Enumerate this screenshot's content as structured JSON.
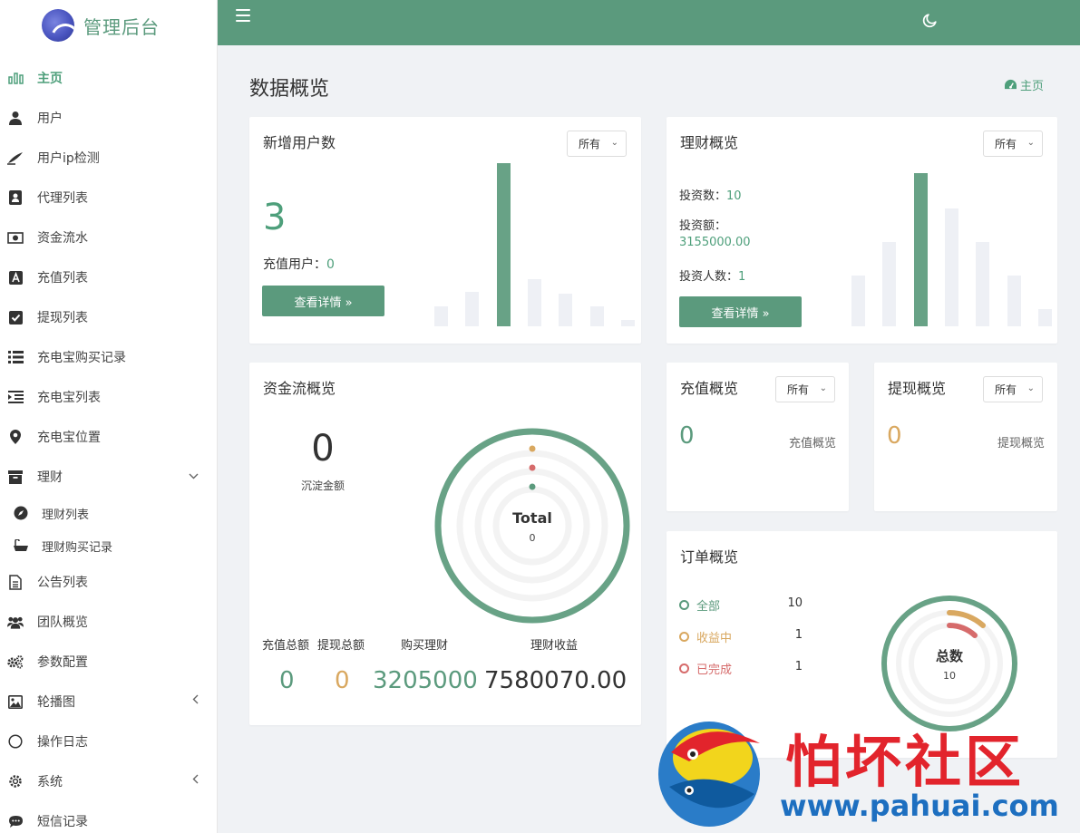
{
  "brand": {
    "name": "管理后台"
  },
  "sidebar": {
    "items": [
      {
        "label": "主页",
        "icon": "bar-chart-icon"
      },
      {
        "label": "用户",
        "icon": "user-icon"
      },
      {
        "label": "用户ip检测",
        "icon": "pen-icon"
      },
      {
        "label": "代理列表",
        "icon": "contact-icon"
      },
      {
        "label": "资金流水",
        "icon": "money-icon"
      },
      {
        "label": "充值列表",
        "icon": "letter-a-icon"
      },
      {
        "label": "提现列表",
        "icon": "check-square-icon"
      },
      {
        "label": "充电宝购买记录",
        "icon": "list-icon"
      },
      {
        "label": "充电宝列表",
        "icon": "indent-icon"
      },
      {
        "label": "充电宝位置",
        "icon": "map-pin-icon"
      },
      {
        "label": "理财",
        "icon": "archive-icon"
      },
      {
        "label": "理财列表",
        "icon": "compass-icon"
      },
      {
        "label": "理财购买记录",
        "icon": "bath-icon"
      },
      {
        "label": "公告列表",
        "icon": "file-text-icon"
      },
      {
        "label": "团队概览",
        "icon": "users-icon"
      },
      {
        "label": "参数配置",
        "icon": "cogs-icon"
      },
      {
        "label": "轮播图",
        "icon": "image-icon"
      },
      {
        "label": "操作日志",
        "icon": "circle-icon"
      },
      {
        "label": "系统",
        "icon": "gear-icon"
      },
      {
        "label": "短信记录",
        "icon": "comment-icon"
      }
    ]
  },
  "header": {
    "page_title": "数据概览",
    "breadcrumb": "主页"
  },
  "select_default": "所有",
  "new_users": {
    "title": "新增用户数",
    "count": "3",
    "recharge_label": "充值用户：",
    "recharge_value": "0",
    "button": "查看详情 »",
    "bars": [
      0.12,
      0.21,
      1.0,
      0.29,
      0.2,
      0.12,
      0.04
    ],
    "highlight": 2
  },
  "finance": {
    "title": "理财概览",
    "invest_count_label": "投资数：",
    "invest_count": "10",
    "invest_amount_label": "投资额：",
    "invest_amount": "3155000.00",
    "investor_label": "投资人数：",
    "investor_count": "1",
    "button": "查看详情 »",
    "bars": [
      0.33,
      0.55,
      1.0,
      0.77,
      0.55,
      0.33,
      0.11
    ],
    "highlight": 2
  },
  "funds": {
    "title": "资金流概览",
    "deposit_value": "0",
    "deposit_label": "沉淀金额",
    "ring_title": "Total",
    "ring_value": "0",
    "stat_labels": [
      "充值总额",
      "提现总额",
      "购买理财",
      "理财收益"
    ],
    "stat_values": [
      "0",
      "0",
      "3205000",
      "7580070.00"
    ]
  },
  "recharge": {
    "title": "充值概览",
    "value": "0",
    "label": "充值概览"
  },
  "withdraw": {
    "title": "提现概览",
    "value": "0",
    "label": "提现概览"
  },
  "orders": {
    "title": "订单概览",
    "rows": [
      {
        "label": "全部",
        "value": "10",
        "color": "#5b9a7d"
      },
      {
        "label": "收益中",
        "value": "1",
        "color": "#d9a860"
      },
      {
        "label": "已完成",
        "value": "1",
        "color": "#d66b6b"
      }
    ],
    "ring_title": "总数",
    "ring_value": "10"
  },
  "watermark": {
    "title": "怕坏社区",
    "url": "www.pahuai.com"
  },
  "colors": {
    "primary": "#5b9a7d",
    "accent_orange": "#d9a860",
    "accent_red": "#d66b6b"
  }
}
